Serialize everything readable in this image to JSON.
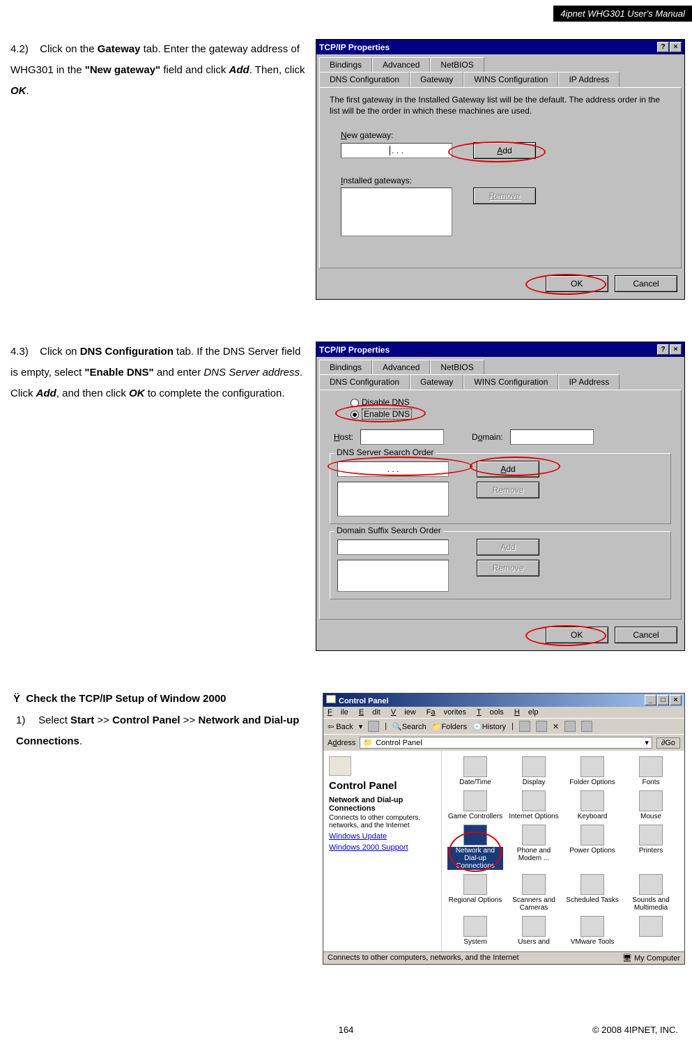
{
  "header": {
    "title": "4ipnet WHG301 User's Manual"
  },
  "step42": {
    "num": "4.2)",
    "text_parts": {
      "a": "Click on the ",
      "b": "Gateway",
      "c": " tab. Enter the gateway address of WHG301 in the ",
      "d": "\"New gateway\"",
      "e": " field and click ",
      "f": "Add",
      "g": ". Then, click ",
      "h": "OK",
      "i": "."
    }
  },
  "dialog42": {
    "title": "TCP/IP Properties",
    "tabs_row1": [
      "Bindings",
      "Advanced",
      "NetBIOS"
    ],
    "tabs_row2": [
      "DNS Configuration",
      "Gateway",
      "WINS Configuration",
      "IP Address"
    ],
    "active_tab": "Gateway",
    "info": "The first gateway in the Installed Gateway list will be the default. The address order in the list will be the order in which these machines are used.",
    "new_gateway_label": "New gateway:",
    "ip_dots": ".       .       .",
    "add": "Add",
    "installed_label": "Installed gateways:",
    "remove": "Remove",
    "ok": "OK",
    "cancel": "Cancel"
  },
  "step43": {
    "num": "4.3)",
    "text_parts": {
      "a": "Click on ",
      "b": "DNS Configuration",
      "c": " tab. If the DNS Server field is empty, select ",
      "d": "\"Enable DNS\"",
      "e": " and enter ",
      "f": "DNS Server address",
      "g": ". Click ",
      "h": "Add",
      "i": ", and then click ",
      "j": "OK",
      "k": " to complete the configuration."
    }
  },
  "dialog43": {
    "title": "TCP/IP Properties",
    "tabs_row1": [
      "Bindings",
      "Advanced",
      "NetBIOS"
    ],
    "tabs_row2": [
      "DNS Configuration",
      "Gateway",
      "WINS Configuration",
      "IP Address"
    ],
    "active_tab": "DNS Configuration",
    "disable": "Disable DNS",
    "enable": "Enable DNS",
    "host": "Host:",
    "domain": "Domain:",
    "search_order": "DNS Server Search Order",
    "ip_dots": ".       .       .",
    "add": "Add",
    "remove": "Remove",
    "suffix": "Domain Suffix Search Order",
    "add2": "Add",
    "remove2": "Remove",
    "ok": "OK",
    "cancel": "Cancel"
  },
  "section": {
    "bullet": "Ÿ",
    "heading": "Check the TCP/IP Setup of Window 2000",
    "step1": {
      "num": "1)",
      "a": "Select ",
      "b": "Start",
      "c": " >> ",
      "d": "Control Panel",
      "e": " >> ",
      "f": "Network and Dial-up Connections",
      "g": "."
    }
  },
  "cp": {
    "title": "Control Panel",
    "menu": [
      "File",
      "Edit",
      "View",
      "Favorites",
      "Tools",
      "Help"
    ],
    "toolbar": {
      "back": "Back",
      "search": "Search",
      "folders": "Folders",
      "history": "History"
    },
    "addr_label": "Address",
    "addr_value": "Control Panel",
    "go": "Go",
    "left_title": "Control Panel",
    "sub_bold": "Network and Dial-up Connections",
    "sub_desc": "Connects to other computers, networks, and the Internet",
    "link1": "Windows Update",
    "link2": "Windows 2000 Support",
    "icons": [
      "Date/Time",
      "Display",
      "Folder Options",
      "Fonts",
      "Game Controllers",
      "Internet Options",
      "Keyboard",
      "Mouse",
      "Network and Dial-up Connections",
      "Phone and Modem ...",
      "Power Options",
      "Printers",
      "Regional Options",
      "Scanners and Cameras",
      "Scheduled Tasks",
      "Sounds and Multimedia",
      "System",
      "Users and",
      "VMware Tools",
      ""
    ],
    "status_left": "Connects to other computers, networks, and the Internet",
    "status_right": "My Computer"
  },
  "footer": {
    "page": "164",
    "copyright": "© 2008 4IPNET, INC."
  }
}
